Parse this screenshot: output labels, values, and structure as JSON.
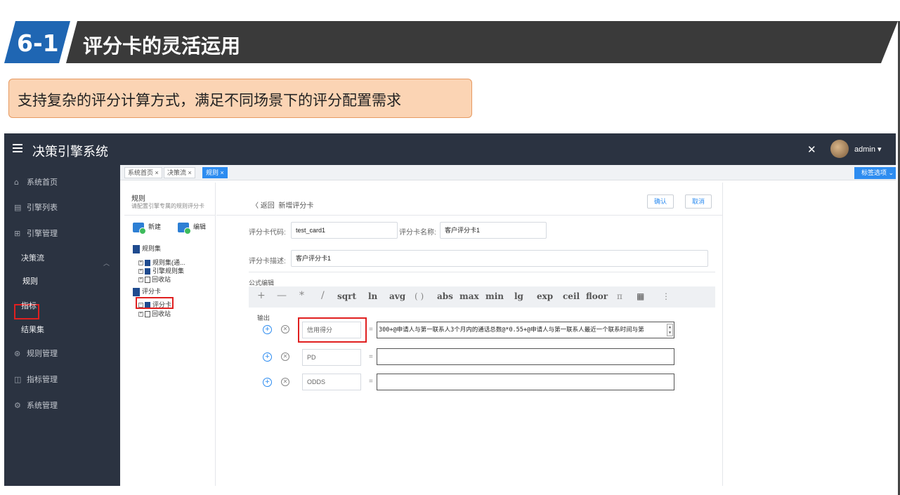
{
  "slide": {
    "number": "6-1",
    "title": "评分卡的灵活运用",
    "callout": "支持复杂的评分计算方式，满足不同场景下的评分配置需求"
  },
  "app": {
    "title": "决策引擎系统",
    "user": "admin ▾",
    "tag_options": "标签选项 ⌄"
  },
  "sidebar": {
    "home": "系统首页",
    "engine_list": "引擎列表",
    "engine_manage": "引擎管理",
    "sub_items": [
      "决策流",
      "规则",
      "指标",
      "结果集"
    ],
    "rule_manage": "规则管理",
    "indicator_manage": "指标管理",
    "system_manage": "系统管理"
  },
  "tabs": [
    "系统首页 ×",
    "决策流 ×",
    "规则 ×"
  ],
  "tree": {
    "title": "规则",
    "subtitle": "请配置引擎专属的规则评分卡",
    "new_label": "新建",
    "edit_label": "编辑",
    "nodes": [
      "规则集",
      "规则集(通...",
      "引擎规则集",
      "回收站",
      "评分卡",
      "评分卡",
      "回收站"
    ]
  },
  "form": {
    "back": "〈 返回",
    "heading": "新增评分卡",
    "confirm": "确认",
    "cancel": "取消",
    "code_label": "评分卡代码:",
    "code_value": "test_card1",
    "name_label": "评分卡名称:",
    "name_value": "客户评分卡1",
    "desc_label": "评分卡描述:",
    "desc_value": "客户评分卡1",
    "formula_title": "公式编辑",
    "toolbar": [
      "+",
      "—",
      "*",
      "/",
      "sqrt",
      "ln",
      "avg",
      "( )",
      "abs",
      "max",
      "min",
      "lg",
      "exp",
      "ceil",
      "floor",
      "π",
      "▦",
      "⋮"
    ],
    "output_label": "输出",
    "rows": [
      {
        "var": "信用得分",
        "expr": "300+@申请人与第一联系人3个月内的通话总数@*0.55+@申请人与第一联系人最近一个联系时间与第"
      },
      {
        "var": "PD",
        "expr": ""
      },
      {
        "var": "ODDS",
        "expr": ""
      }
    ],
    "equals": "="
  }
}
